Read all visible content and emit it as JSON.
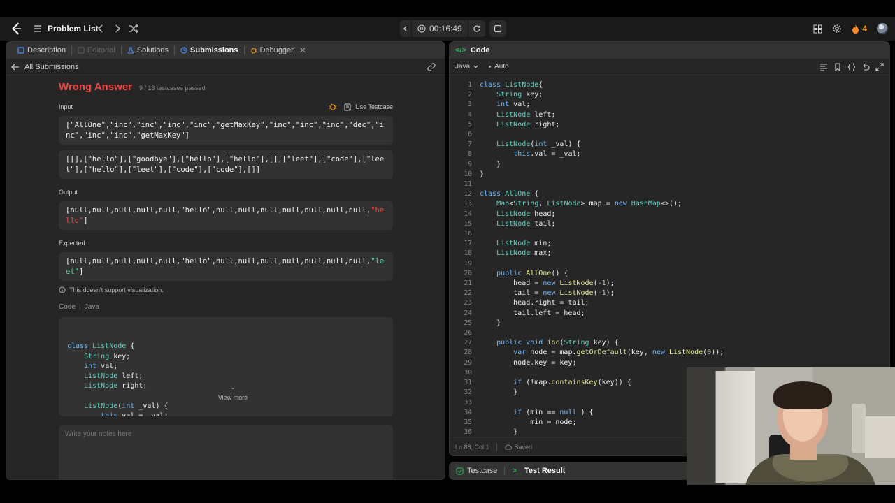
{
  "nav": {
    "problem_list": "Problem List",
    "timer": "00:16:49",
    "streak": "4"
  },
  "left": {
    "tabs": [
      {
        "label": "Description"
      },
      {
        "label": "Editorial"
      },
      {
        "label": "Solutions"
      },
      {
        "label": "Submissions"
      },
      {
        "label": "Debugger"
      }
    ],
    "back_label": "All Submissions",
    "verdict": "Wrong Answer",
    "testcases": "9 / 18 testcases passed",
    "input_label": "Input",
    "use_testcase": "Use Testcase",
    "input_line1": "[\"AllOne\",\"inc\",\"inc\",\"inc\",\"inc\",\"getMaxKey\",\"inc\",\"inc\",\"inc\",\"dec\",\"inc\",\"inc\",\"inc\",\"getMaxKey\"]",
    "input_line2": "[[],[\"hello\"],[\"goodbye\"],[\"hello\"],[\"hello\"],[],[\"leet\"],[\"code\"],[\"leet\"],[\"hello\"],[\"leet\"],[\"code\"],[\"code\"],[]]",
    "output_label": "Output",
    "output_prefix": "[null,null,null,null,null,\"hello\",null,null,null,null,null,null,null,",
    "output_str": "\"hello\"",
    "output_suffix": "]",
    "expected_label": "Expected",
    "expected_prefix": "[null,null,null,null,null,\"hello\",null,null,null,null,null,null,null,",
    "expected_str": "\"leet\"",
    "expected_suffix": "]",
    "viz_note": "This doesn't support visualization.",
    "code_label": "Code",
    "code_lang": "Java",
    "view_more": "View more",
    "notes_placeholder": "Write your notes here"
  },
  "right": {
    "code_tab": "Code",
    "language": "Java",
    "auto": "Auto",
    "status_pos": "Ln 88, Col 1",
    "status_saved": "Saved"
  },
  "bottom": {
    "testcase": "Testcase",
    "test_result": "Test Result"
  },
  "code": [
    [
      [
        "kw",
        "class "
      ],
      [
        "cls",
        "ListNode"
      ],
      [
        "",
        "{"
      ]
    ],
    [
      [
        "",
        "    "
      ],
      [
        "ty",
        "String"
      ],
      [
        "",
        " key;"
      ]
    ],
    [
      [
        "",
        "    "
      ],
      [
        "kw",
        "int"
      ],
      [
        "",
        " val;"
      ]
    ],
    [
      [
        "",
        "    "
      ],
      [
        "ty",
        "ListNode"
      ],
      [
        "",
        " left;"
      ]
    ],
    [
      [
        "",
        "    "
      ],
      [
        "ty",
        "ListNode"
      ],
      [
        "",
        " right;"
      ]
    ],
    [
      [
        "",
        ""
      ]
    ],
    [
      [
        "",
        "    "
      ],
      [
        "ty",
        "ListNode"
      ],
      [
        "",
        "("
      ],
      [
        "kw",
        "int"
      ],
      [
        "",
        " _val) {"
      ]
    ],
    [
      [
        "",
        "        "
      ],
      [
        "kw",
        "this"
      ],
      [
        "",
        ".val = _val;"
      ]
    ],
    [
      [
        "",
        "    }"
      ]
    ],
    [
      [
        "",
        "}"
      ]
    ],
    [
      [
        "",
        ""
      ]
    ],
    [
      [
        "kw",
        "class "
      ],
      [
        "cls",
        "AllOne"
      ],
      [
        "",
        " {"
      ]
    ],
    [
      [
        "",
        "    "
      ],
      [
        "ty",
        "Map"
      ],
      [
        "",
        "<"
      ],
      [
        "ty",
        "String"
      ],
      [
        "",
        ", "
      ],
      [
        "ty",
        "ListNode"
      ],
      [
        "",
        "> map = "
      ],
      [
        "kw",
        "new "
      ],
      [
        "ty",
        "HashMap"
      ],
      [
        "",
        "<>();"
      ]
    ],
    [
      [
        "",
        "    "
      ],
      [
        "ty",
        "ListNode"
      ],
      [
        "",
        " head;"
      ]
    ],
    [
      [
        "",
        "    "
      ],
      [
        "ty",
        "ListNode"
      ],
      [
        "",
        " tail;"
      ]
    ],
    [
      [
        "",
        ""
      ]
    ],
    [
      [
        "",
        "    "
      ],
      [
        "ty",
        "ListNode"
      ],
      [
        "",
        " min;"
      ]
    ],
    [
      [
        "",
        "    "
      ],
      [
        "ty",
        "ListNode"
      ],
      [
        "",
        " max;"
      ]
    ],
    [
      [
        "",
        ""
      ]
    ],
    [
      [
        "",
        "    "
      ],
      [
        "kw",
        "public "
      ],
      [
        "fn",
        "AllOne"
      ],
      [
        "",
        "() {"
      ]
    ],
    [
      [
        "",
        "        head = "
      ],
      [
        "kw",
        "new "
      ],
      [
        "fn",
        "ListNode"
      ],
      [
        "",
        "("
      ],
      [
        "nm",
        "-1"
      ],
      [
        "",
        ");"
      ]
    ],
    [
      [
        "",
        "        tail = "
      ],
      [
        "kw",
        "new "
      ],
      [
        "fn",
        "ListNode"
      ],
      [
        "",
        "("
      ],
      [
        "nm",
        "-1"
      ],
      [
        "",
        ");"
      ]
    ],
    [
      [
        "",
        "        head.right = tail;"
      ]
    ],
    [
      [
        "",
        "        tail.left = head;"
      ]
    ],
    [
      [
        "",
        "    }"
      ]
    ],
    [
      [
        "",
        ""
      ]
    ],
    [
      [
        "",
        "    "
      ],
      [
        "kw",
        "public void "
      ],
      [
        "fn",
        "inc"
      ],
      [
        "",
        "("
      ],
      [
        "ty",
        "String"
      ],
      [
        "",
        " key) {"
      ]
    ],
    [
      [
        "",
        "        "
      ],
      [
        "kw",
        "var"
      ],
      [
        "",
        " node = map."
      ],
      [
        "fn",
        "getOrDefault"
      ],
      [
        "",
        "(key, "
      ],
      [
        "kw",
        "new "
      ],
      [
        "fn",
        "ListNode"
      ],
      [
        "",
        "("
      ],
      [
        "nm",
        "0"
      ],
      [
        "",
        "));"
      ]
    ],
    [
      [
        "",
        "        node.key = key;"
      ]
    ],
    [
      [
        "",
        ""
      ]
    ],
    [
      [
        "",
        "        "
      ],
      [
        "kw",
        "if"
      ],
      [
        "",
        " (!map."
      ],
      [
        "fn",
        "containsKey"
      ],
      [
        "",
        "(key)) {"
      ]
    ],
    [
      [
        "",
        "        }"
      ]
    ],
    [
      [
        "",
        ""
      ]
    ],
    [
      [
        "",
        "        "
      ],
      [
        "kw",
        "if"
      ],
      [
        "",
        " (min == "
      ],
      [
        "kw",
        "null"
      ],
      [
        "",
        " ) {"
      ]
    ],
    [
      [
        "",
        "            min = node;"
      ]
    ],
    [
      [
        "",
        "        }"
      ]
    ]
  ],
  "preview_code": [
    [
      [
        "kw",
        "class "
      ],
      [
        "cls",
        "ListNode"
      ],
      [
        "",
        " {"
      ]
    ],
    [
      [
        "",
        "    "
      ],
      [
        "ty",
        "String"
      ],
      [
        "",
        " key;"
      ]
    ],
    [
      [
        "",
        "    "
      ],
      [
        "kw",
        "int"
      ],
      [
        "",
        " val;"
      ]
    ],
    [
      [
        "",
        "    "
      ],
      [
        "ty",
        "ListNode"
      ],
      [
        "",
        " left;"
      ]
    ],
    [
      [
        "",
        "    "
      ],
      [
        "ty",
        "ListNode"
      ],
      [
        "",
        " right;"
      ]
    ],
    [
      [
        "",
        ""
      ]
    ],
    [
      [
        "",
        "    "
      ],
      [
        "ty",
        "ListNode"
      ],
      [
        "",
        "("
      ],
      [
        "kw",
        "int"
      ],
      [
        "",
        " _val) {"
      ]
    ],
    [
      [
        "",
        "        "
      ],
      [
        "kw",
        "this"
      ],
      [
        "",
        ".val = _val;"
      ]
    ]
  ]
}
